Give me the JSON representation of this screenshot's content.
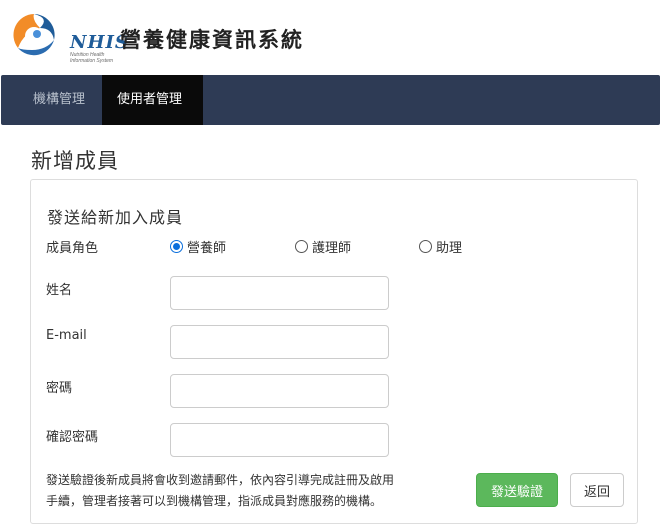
{
  "header": {
    "logo_text": "NHIS",
    "logo_subtitle": "Nutrition Health Information System",
    "app_title": "營養健康資訊系統"
  },
  "navbar": {
    "tabs": [
      {
        "label": "機構管理",
        "active": false
      },
      {
        "label": "使用者管理",
        "active": true
      }
    ]
  },
  "page": {
    "heading": "新增成員"
  },
  "form": {
    "section_title": "發送給新加入成員",
    "role_label": "成員角色",
    "roles": [
      {
        "label": "營養師",
        "checked": true
      },
      {
        "label": "護理師",
        "checked": false
      },
      {
        "label": "助理",
        "checked": false
      }
    ],
    "name_label": "姓名",
    "name_value": "",
    "email_label": "E-mail",
    "email_value": "",
    "password_label": "密碼",
    "password_value": "",
    "confirm_label": "確認密碼",
    "confirm_value": "",
    "note_line1": "發送驗證後新成員將會收到邀請郵件，依內容引導完成註冊及啟用",
    "note_line2": "手續，管理者接著可以到機構管理，指派成員對應服務的機構。",
    "submit_label": "發送驗證",
    "back_label": "返回"
  },
  "colors": {
    "navbar_bg": "#2e3b55",
    "active_tab_bg": "#0a0a0a",
    "submit_bg": "#5cb85c",
    "radio_accent": "#0b6fdc",
    "logo_blue": "#1f5c99",
    "logo_orange": "#f28c28"
  }
}
